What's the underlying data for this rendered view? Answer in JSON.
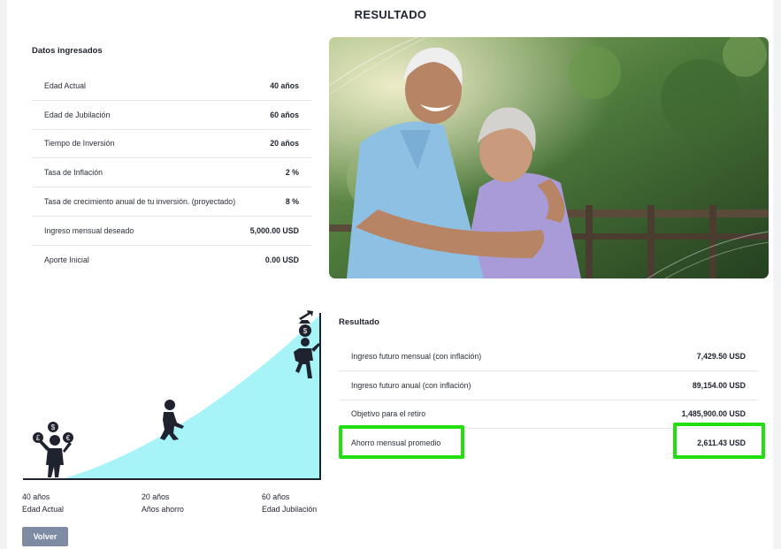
{
  "header": {
    "title": "RESULTADO"
  },
  "inputs": {
    "title": "Datos ingresados",
    "rows": [
      {
        "label": "Edad Actual",
        "value": "40 años"
      },
      {
        "label": "Edad de Jubilación",
        "value": "60 años"
      },
      {
        "label": "Tiempo de Inversión",
        "value": "20 años"
      },
      {
        "label": "Tasa de Inflación",
        "value": "2 %"
      },
      {
        "label": "Tasa de crecimiento anual de tu inversión. (proyectado)",
        "value": "8 %"
      },
      {
        "label": "Ingreso mensual deseado",
        "value": "5,000.00 USD"
      },
      {
        "label": "Aporte Inicial",
        "value": "0.00 USD"
      }
    ]
  },
  "results": {
    "title": "Resultado",
    "rows": [
      {
        "label": "Ingreso futuro mensual (con inflación)",
        "value": "7,429.50 USD"
      },
      {
        "label": "Ingreso futuro anual (con inflación)",
        "value": "89,154.00 USD"
      },
      {
        "label": "Objetivo para el retiro",
        "value": "1,485,900.00 USD"
      },
      {
        "label": "Ahorro mensual promedio",
        "value": "2,611.43 USD"
      }
    ]
  },
  "growth_chart": {
    "axis": [
      {
        "value": "40 años",
        "caption": "Edad Actual"
      },
      {
        "value": "20 años",
        "caption": "Años ahorro"
      },
      {
        "value": "60 años",
        "caption": "Edad Jubilación"
      }
    ],
    "fill_color": "#a6f4f7",
    "coin_symbols": [
      "£",
      "$",
      "€",
      "$"
    ]
  },
  "photo": {
    "icon": "elderly-couple-photo"
  },
  "highlight_color": "#22e010",
  "actions": {
    "back_label": "Volver"
  }
}
